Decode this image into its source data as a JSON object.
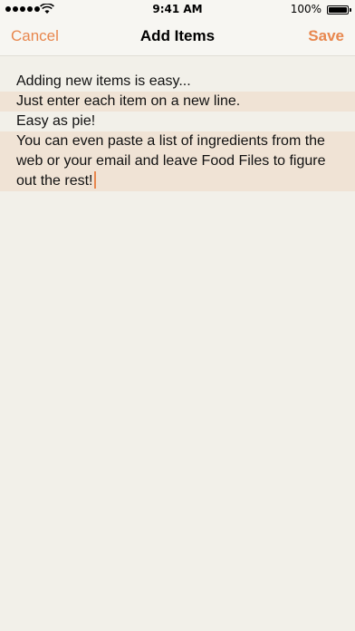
{
  "status_bar": {
    "time": "9:41 AM",
    "battery_percent": "100%",
    "signal_icon": "signal-dots-icon",
    "wifi_icon": "wifi-icon",
    "battery_icon": "battery-icon"
  },
  "nav": {
    "cancel_label": "Cancel",
    "title": "Add Items",
    "save_label": "Save"
  },
  "editor": {
    "lines": [
      "Adding new items is easy...",
      "Just enter each item on a new line.",
      "Easy as pie!",
      "You can even paste a list of ingredients from the web or your email and leave Food Files to figure out the rest!"
    ]
  },
  "colors": {
    "accent": "#e8874e",
    "background": "#f2f0e9",
    "line_highlight": "#f0e3d5"
  }
}
